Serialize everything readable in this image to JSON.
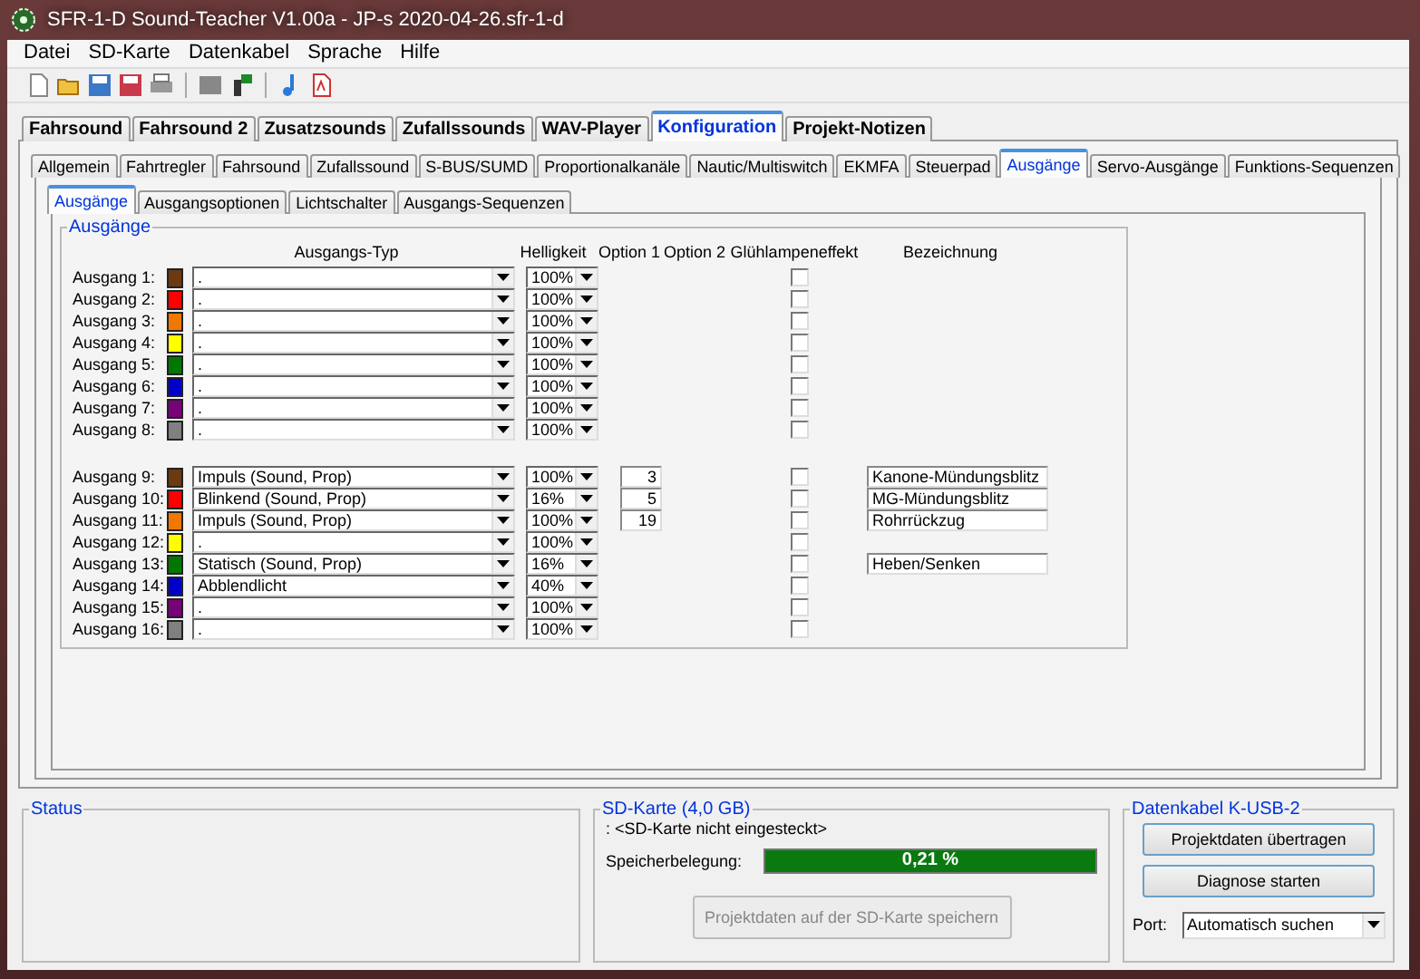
{
  "window": {
    "title": "SFR-1-D Sound-Teacher V1.00a - JP-s 2020-04-26.sfr-1-d"
  },
  "menu": [
    "Datei",
    "SD-Karte",
    "Datenkabel",
    "Sprache",
    "Hilfe"
  ],
  "main_tabs": [
    {
      "label": "Fahrsound",
      "selected": false
    },
    {
      "label": "Fahrsound 2",
      "selected": false
    },
    {
      "label": "Zusatzsounds",
      "selected": false
    },
    {
      "label": "Zufallssounds",
      "selected": false
    },
    {
      "label": "WAV-Player",
      "selected": false
    },
    {
      "label": "Konfiguration",
      "selected": true
    },
    {
      "label": "Projekt-Notizen",
      "selected": false
    }
  ],
  "sub_tabs": [
    {
      "label": "Allgemein",
      "selected": false
    },
    {
      "label": "Fahrtregler",
      "selected": false
    },
    {
      "label": "Fahrsound",
      "selected": false
    },
    {
      "label": "Zufallssound",
      "selected": false
    },
    {
      "label": "S-BUS/SUMD",
      "selected": false
    },
    {
      "label": "Proportionalkanäle",
      "selected": false
    },
    {
      "label": "Nautic/Multiswitch",
      "selected": false
    },
    {
      "label": "EKMFA",
      "selected": false
    },
    {
      "label": "Steuerpad",
      "selected": false
    },
    {
      "label": "Ausgänge",
      "selected": true
    },
    {
      "label": "Servo-Ausgänge",
      "selected": false
    },
    {
      "label": "Funktions-Sequenzen",
      "selected": false
    }
  ],
  "inner_tabs": [
    {
      "label": "Ausgänge",
      "selected": true
    },
    {
      "label": "Ausgangsoptionen",
      "selected": false
    },
    {
      "label": "Lichtschalter",
      "selected": false
    },
    {
      "label": "Ausgangs-Sequenzen",
      "selected": false
    }
  ],
  "outputs_group": {
    "title": "Ausgänge",
    "columns": [
      "Ausgangs-Typ",
      "Helligkeit",
      "Option 1",
      "Option 2",
      "Glühlampeneffekt",
      "Bezeichnung"
    ],
    "rows": [
      {
        "label": "Ausgang 1:",
        "color": "#6b3a10",
        "type": ".",
        "brightness": "100%",
        "glow": false
      },
      {
        "label": "Ausgang 2:",
        "color": "#ff0000",
        "type": ".",
        "brightness": "100%",
        "glow": false
      },
      {
        "label": "Ausgang 3:",
        "color": "#f07800",
        "type": ".",
        "brightness": "100%",
        "glow": false
      },
      {
        "label": "Ausgang 4:",
        "color": "#ffff00",
        "type": ".",
        "brightness": "100%",
        "glow": false
      },
      {
        "label": "Ausgang 5:",
        "color": "#007800",
        "type": ".",
        "brightness": "100%",
        "glow": false
      },
      {
        "label": "Ausgang 6:",
        "color": "#0000c8",
        "type": ".",
        "brightness": "100%",
        "glow": false
      },
      {
        "label": "Ausgang 7:",
        "color": "#780078",
        "type": ".",
        "brightness": "100%",
        "glow": false
      },
      {
        "label": "Ausgang 8:",
        "color": "#808080",
        "type": ".",
        "brightness": "100%",
        "glow": false
      },
      {
        "label": "Ausgang 9:",
        "color": "#6b3a10",
        "type": "Impuls (Sound, Prop)",
        "brightness": "100%",
        "option_1": "3",
        "glow": false,
        "name": "Kanone-Mündungsblitz"
      },
      {
        "label": "Ausgang 10:",
        "color": "#ff0000",
        "type": "Blinkend (Sound, Prop)",
        "brightness": "16%",
        "option_1": "5",
        "glow": false,
        "name": "MG-Mündungsblitz"
      },
      {
        "label": "Ausgang 11:",
        "color": "#f07800",
        "type": "Impuls (Sound, Prop)",
        "brightness": "100%",
        "option_1": "19",
        "glow": false,
        "name": "Rohrrückzug"
      },
      {
        "label": "Ausgang 12:",
        "color": "#ffff00",
        "type": ".",
        "brightness": "100%",
        "glow": false
      },
      {
        "label": "Ausgang 13:",
        "color": "#007800",
        "type": "Statisch (Sound, Prop)",
        "brightness": "16%",
        "glow": false,
        "name": "Heben/Senken"
      },
      {
        "label": "Ausgang 14:",
        "color": "#0000c8",
        "type": "Abblendlicht",
        "brightness": "40%",
        "glow": false
      },
      {
        "label": "Ausgang 15:",
        "color": "#780078",
        "type": ".",
        "brightness": "100%",
        "glow": false
      },
      {
        "label": "Ausgang 16:",
        "color": "#808080",
        "type": ".",
        "brightness": "100%",
        "glow": false
      }
    ]
  },
  "status": {
    "title": "Status"
  },
  "sd_card": {
    "title": "SD-Karte (4,0 GB)",
    "state": ": <SD-Karte nicht eingesteckt>",
    "usage_label": "Speicherbelegung:",
    "usage": {
      "level": 1,
      "reading": "0,21 %"
    },
    "save_button": {
      "label": "Projektdaten auf der SD-Karte speichern",
      "disabled": true
    }
  },
  "cable": {
    "title": "Datenkabel K-USB-2",
    "buttons": [
      "Projektdaten übertragen",
      "Diagnose starten"
    ],
    "port_label": "Port:",
    "port": "Automatisch suchen"
  }
}
